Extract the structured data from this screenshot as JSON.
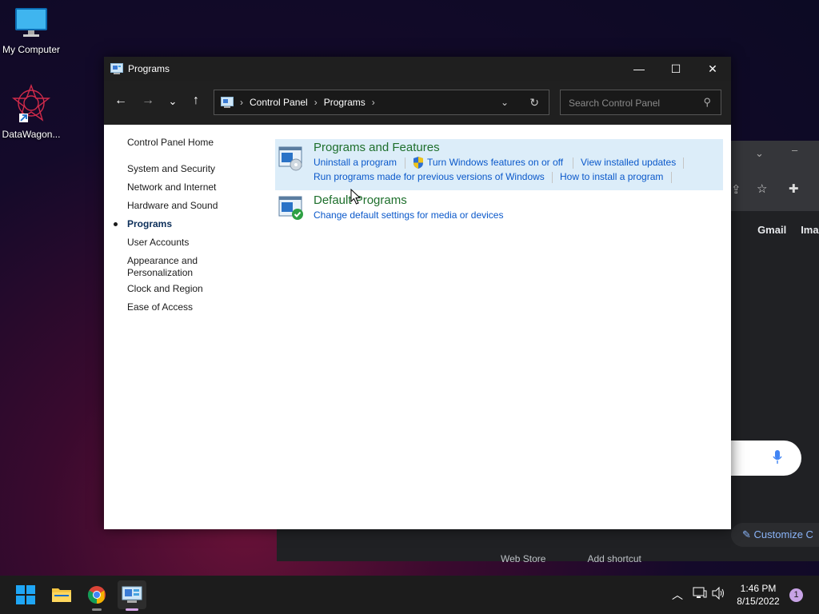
{
  "desktop": {
    "icons": [
      {
        "label": "My Computer"
      },
      {
        "label": "DataWagon..."
      }
    ]
  },
  "background_window": {
    "links": [
      "Gmail",
      "Images"
    ],
    "customize_label": "Customize C",
    "shortcuts": [
      "Web Store",
      "Add shortcut"
    ]
  },
  "window": {
    "title": "Programs",
    "controls": {
      "minimize": "—",
      "maximize": "☐",
      "close": "✕"
    }
  },
  "nav": {
    "breadcrumb": [
      "Control Panel",
      "Programs"
    ],
    "search_placeholder": "Search Control Panel"
  },
  "sidebar": {
    "items": [
      {
        "label": "Control Panel Home"
      },
      {
        "label": "System and Security"
      },
      {
        "label": "Network and Internet"
      },
      {
        "label": "Hardware and Sound"
      },
      {
        "label": "Programs"
      },
      {
        "label": "User Accounts"
      },
      {
        "label": "Appearance and Personalization"
      },
      {
        "label": "Clock and Region"
      },
      {
        "label": "Ease of Access"
      }
    ]
  },
  "categories": [
    {
      "title": "Programs and Features",
      "links": [
        "Uninstall a program",
        "Turn Windows features on or off",
        "View installed updates",
        "Run programs made for previous versions of Windows",
        "How to install a program"
      ]
    },
    {
      "title": "Default Programs",
      "links": [
        "Change default settings for media or devices"
      ]
    }
  ],
  "taskbar": {
    "time": "1:46 PM",
    "date": "8/15/2022",
    "notification_count": "1"
  },
  "colors": {
    "category_title": "#1e6f2c",
    "link": "#0a58ca",
    "highlight": "#dcedf9",
    "titlebar": "#1f1f1f"
  }
}
